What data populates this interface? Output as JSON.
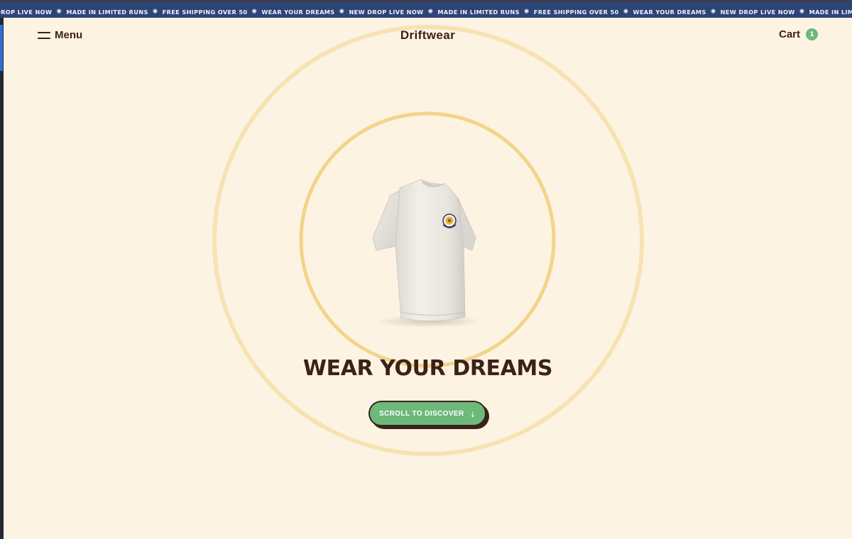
{
  "announcement": {
    "items": [
      "DROP LIVE NOW",
      "MADE IN LIMITED RUNS",
      "FREE SHIPPING OVER 50",
      "WEAR YOUR DREAMS",
      "NEW DROP LIVE NOW",
      "MADE IN LIMITED RUNS",
      "FREE SHIPPING OVER 50",
      "WEAR YOUR DREAMS",
      "NEW DROP LIVE NOW",
      "MADE IN LIMITED RUNS"
    ],
    "separator": "✺"
  },
  "header": {
    "menu_label": "Menu",
    "brand": "Driftwear",
    "cart_label": "Cart",
    "cart_count": "1"
  },
  "hero": {
    "headline": "WEAR YOUR DREAMS",
    "cta_label": "SCROLL TO DISCOVER",
    "cta_arrow": "↓",
    "product_image": "white-tshirt"
  },
  "colors": {
    "background": "#fcf3e3",
    "text": "#3b2219",
    "accent_green": "#6cb97a",
    "ring": "#f2d48a",
    "ticker_bg": "#2c4476"
  }
}
